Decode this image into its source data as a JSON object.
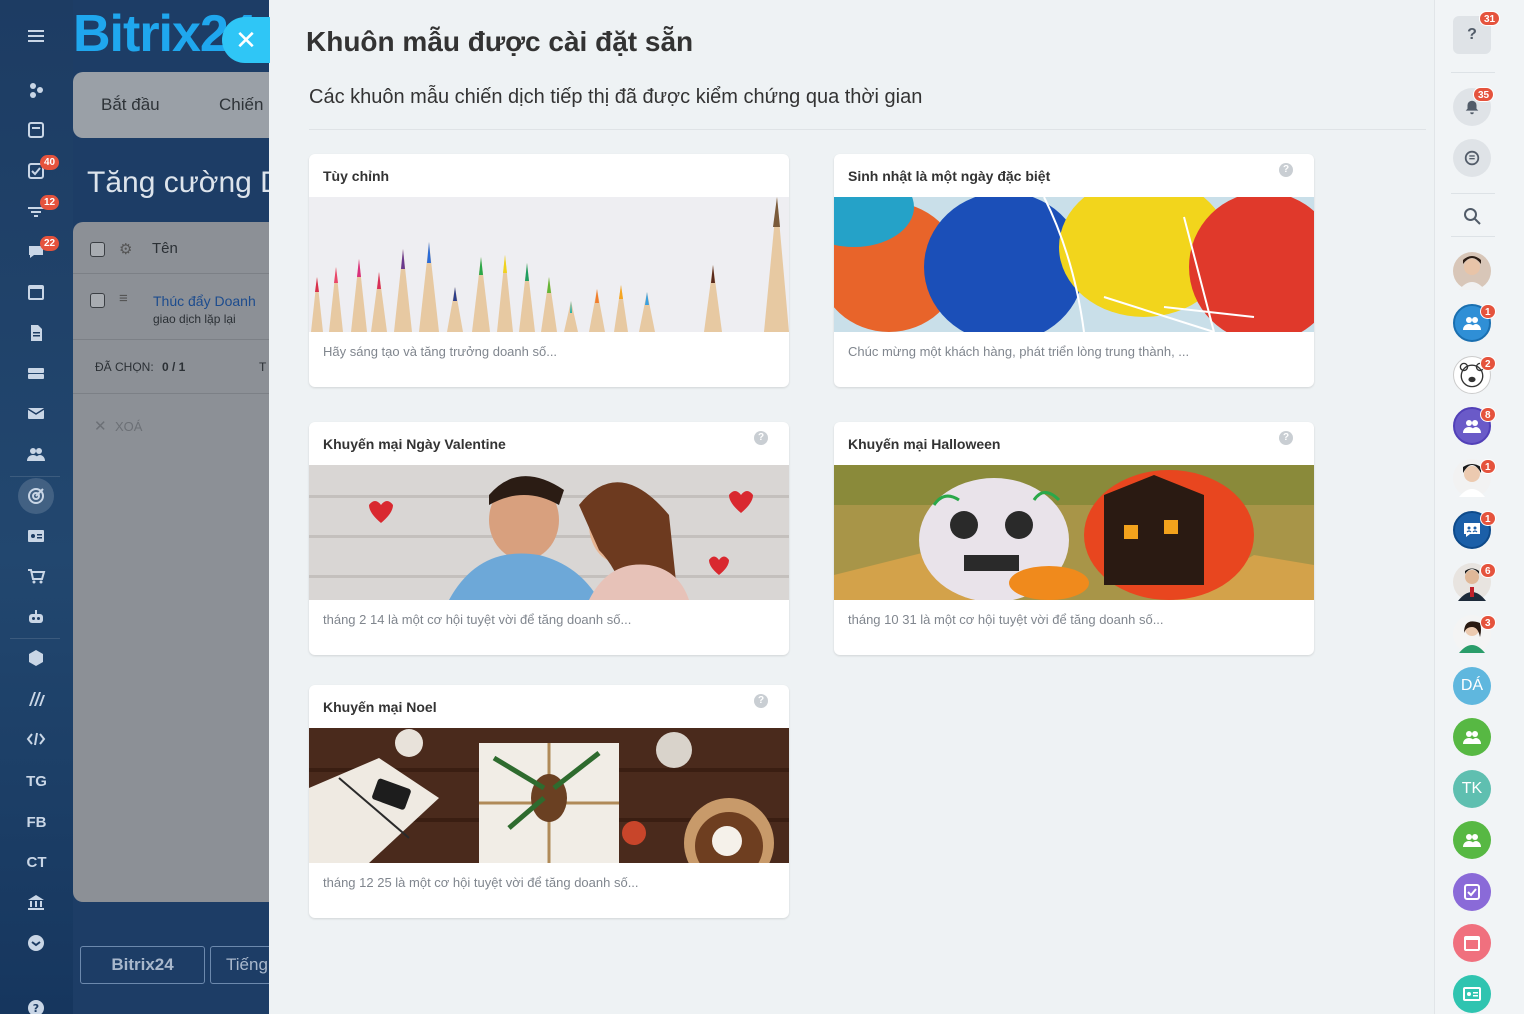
{
  "left_nav": {
    "badges": [
      "40",
      "12",
      "22"
    ],
    "text_items": [
      "TG",
      "FB",
      "CT"
    ]
  },
  "background_app": {
    "logo": "Bitrix24",
    "tabs": [
      "Bắt đầu",
      "Chiến"
    ],
    "page_title": "Tăng cường Do",
    "list": {
      "column_name": "Tên",
      "row_title": "Thúc đẩy Doanh",
      "row_subtitle": "giao dịch lặp lại",
      "selected_label": "ĐÃ CHỌN:",
      "selected_value": "0 / 1",
      "selected_extra": "T",
      "delete_label": "XOÁ"
    },
    "footer": {
      "logo_button": "Bitrix24",
      "language_button": "Tiếng"
    }
  },
  "slider": {
    "title": "Khuôn mẫu được cài đặt sẵn",
    "subtitle": "Các khuôn mẫu chiến dịch tiếp thị đã được kiểm chứng qua thời gian",
    "cards": [
      {
        "title": "Tùy chỉnh",
        "desc": "Hãy sáng tạo và tăng trưởng doanh số...",
        "image": "colored-pencils"
      },
      {
        "title": "Sinh nhật là một ngày đặc biệt",
        "desc": "Chúc mừng một khách hàng, phát triển lòng trung thành, ...",
        "image": "balloons"
      },
      {
        "title": "Khuyến mại Ngày Valentine",
        "desc": "tháng 2 14 là một cơ hội tuyệt vời để tăng doanh số...",
        "image": "couple-hearts"
      },
      {
        "title": "Khuyến mại Halloween",
        "desc": "tháng 10 31 là một cơ hội tuyệt vời để tăng doanh số...",
        "image": "painted-pumpkins"
      },
      {
        "title": "Khuyến mại Noel",
        "desc": "tháng 12 25 là một cơ hội tuyệt vời để tăng doanh số...",
        "image": "christmas-gifts"
      }
    ]
  },
  "right_rail": {
    "help_badge": "31",
    "notifications_badge": "35",
    "chat_badges": [
      "1",
      "2",
      "8",
      "1",
      "1",
      "6",
      "3"
    ],
    "initials": [
      "DÁ",
      "TK"
    ]
  },
  "colors": {
    "accent": "#2fc6f6",
    "badge": "#e5533d",
    "nav_bg": "#1d3c63"
  }
}
